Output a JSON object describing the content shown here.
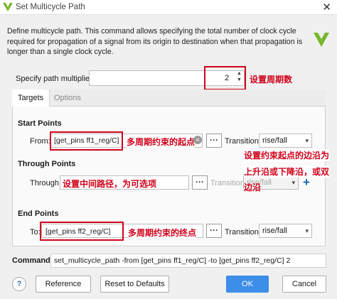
{
  "window": {
    "title": "Set Multicycle Path",
    "close_glyph": "✕"
  },
  "description": "Define multicycle path. This command allows specifying the total number of clock cycle required for propagation of a signal from its origin to destination when that propagation is longer than a single clock cycle.",
  "multiplier": {
    "label": "Specify path multiplier:",
    "value": "2",
    "annotation": "设置周期数"
  },
  "tabs": [
    {
      "label": "Targets",
      "active": true
    },
    {
      "label": "Options",
      "active": false
    }
  ],
  "start_points": {
    "title": "Start Points",
    "from_label": "From:",
    "value": "[get_pins ff1_reg/C]",
    "annotation": "多周期约束的起点",
    "transition_label": "Transition",
    "transition_value": "rise/fall"
  },
  "through_points": {
    "title": "Through Points",
    "through_label": "Through:",
    "annotation": "设置中间路径，为可选项",
    "transition_label": "Transition",
    "transition_value": "rise/fall",
    "add_glyph": "+"
  },
  "end_points": {
    "title": "End Points",
    "to_label": "To:",
    "value": "[get_pins ff2_reg/C]",
    "annotation": "多周期约束的终点",
    "transition_label": "Transition",
    "transition_value": "rise/fall"
  },
  "side_annotation": [
    "设置约束起点的边沿为",
    "上升沿或下降沿，或双",
    "边沿"
  ],
  "command": {
    "label": "Command:",
    "value": "set_multicycle_path -from [get_pins ff1_reg/C] -to [get_pins ff2_reg/C] 2"
  },
  "buttons": {
    "help": "?",
    "reference": "Reference",
    "reset": "Reset to Defaults",
    "ok": "OK",
    "cancel": "Cancel"
  },
  "dots_label": "···",
  "colors": {
    "annotation_red": "#d0021b",
    "ok_blue": "#3d8ee8",
    "plus_blue": "#1565c0",
    "logo_green": "#76b82a"
  }
}
